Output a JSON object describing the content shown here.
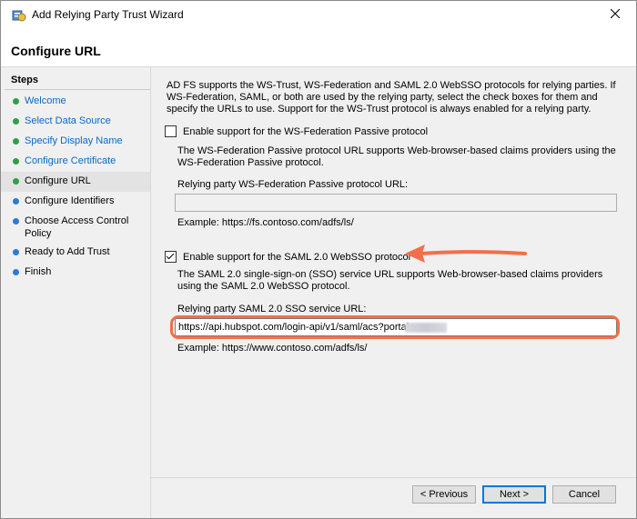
{
  "window": {
    "title": "Add Relying Party Trust Wizard",
    "close_icon": "close-icon",
    "app_icon": "relying-party-wizard-icon"
  },
  "header": {
    "title": "Configure URL"
  },
  "steps": {
    "heading": "Steps",
    "items": [
      {
        "label": "Welcome",
        "state": "done"
      },
      {
        "label": "Select Data Source",
        "state": "done"
      },
      {
        "label": "Specify Display Name",
        "state": "done"
      },
      {
        "label": "Configure Certificate",
        "state": "done"
      },
      {
        "label": "Configure URL",
        "state": "current"
      },
      {
        "label": "Configure Identifiers",
        "state": "pending"
      },
      {
        "label": "Choose Access Control Policy",
        "state": "pending"
      },
      {
        "label": "Ready to Add Trust",
        "state": "pending"
      },
      {
        "label": "Finish",
        "state": "pending"
      }
    ]
  },
  "content": {
    "intro": "AD FS supports the WS-Trust, WS-Federation and SAML 2.0 WebSSO protocols for relying parties.  If WS-Federation, SAML, or both are used by the relying party, select the check boxes for them and specify the URLs to use.  Support for the WS-Trust protocol is always enabled for a relying party.",
    "wsfed": {
      "checkbox_label": "Enable support for the WS-Federation Passive protocol",
      "checked": false,
      "description": "The WS-Federation Passive protocol URL supports Web-browser-based claims providers using the WS-Federation Passive protocol.",
      "field_label": "Relying party WS-Federation Passive protocol URL:",
      "value": "",
      "example": "Example: https://fs.contoso.com/adfs/ls/"
    },
    "saml": {
      "checkbox_label": "Enable support for the SAML 2.0 WebSSO protocol",
      "checked": true,
      "description": "The SAML 2.0 single-sign-on (SSO) service URL supports Web-browser-based claims providers using the SAML 2.0 WebSSO protocol.",
      "field_label": "Relying party SAML 2.0 SSO service URL:",
      "value": "https://api.hubspot.com/login-api/v1/saml/acs?portal=",
      "example": "Example: https://www.contoso.com/adfs/ls/"
    }
  },
  "buttons": {
    "previous": "< Previous",
    "next": "Next >",
    "cancel": "Cancel"
  },
  "colors": {
    "annotation": "#f36f48",
    "link": "#0b67c4",
    "done_dot": "#2ea043",
    "pending_dot": "#2b7bd4"
  }
}
